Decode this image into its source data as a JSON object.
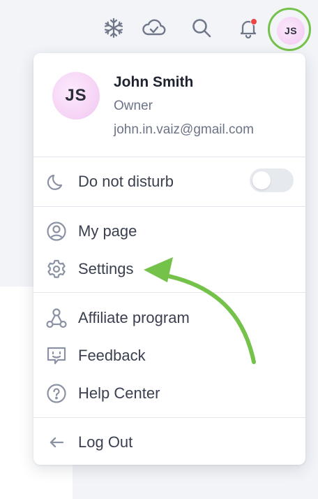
{
  "topbar": {
    "icons": [
      {
        "name": "snowflake-icon"
      },
      {
        "name": "cloud-check-icon"
      },
      {
        "name": "search-icon"
      },
      {
        "name": "bell-icon",
        "has_notification": true
      }
    ],
    "avatar_initials": "JS"
  },
  "profile": {
    "initials": "JS",
    "name": "John Smith",
    "role": "Owner",
    "email": "john.in.vaiz@gmail.com"
  },
  "menu": {
    "do_not_disturb": {
      "label": "Do not disturb",
      "enabled": false,
      "icon": "moon-icon"
    },
    "items": [
      {
        "label": "My page",
        "icon": "user-circle-icon"
      },
      {
        "label": "Settings",
        "icon": "gear-icon"
      },
      {
        "label": "Affiliate program",
        "icon": "affiliate-icon"
      },
      {
        "label": "Feedback",
        "icon": "feedback-icon"
      },
      {
        "label": "Help Center",
        "icon": "help-icon"
      },
      {
        "label": "Log Out",
        "icon": "arrow-left-icon"
      }
    ]
  },
  "colors": {
    "highlight": "#75c24a",
    "notification": "#ef4444",
    "avatar_bg": "#f3c9f3"
  }
}
